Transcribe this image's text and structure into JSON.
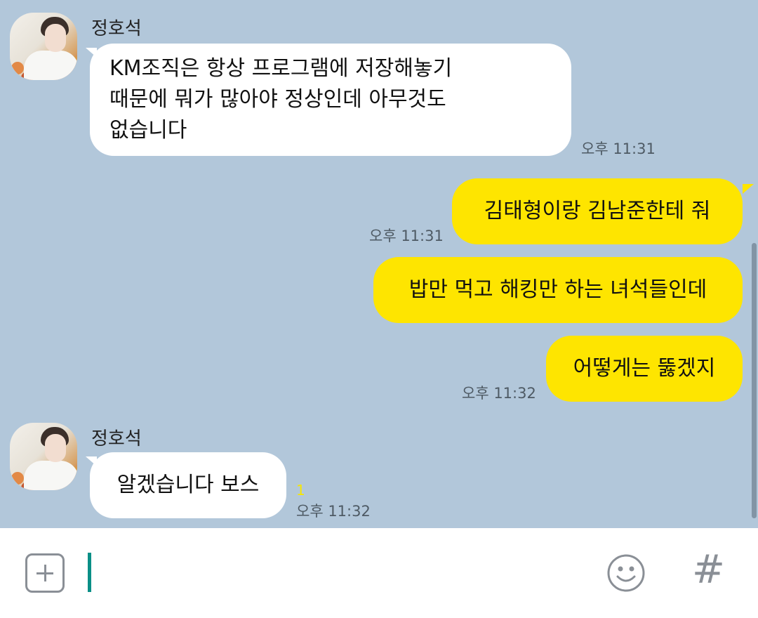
{
  "messages": [
    {
      "sender": "정호석",
      "lines": [
        "KM조직은 항상 프로그램에 저장해놓기",
        "때문에 뭐가 많아야 정상인데 아무것도",
        "없습니다"
      ],
      "time": "오후 11:31",
      "direction": "in"
    },
    {
      "text": "김태형이랑 김남준한테 줘",
      "time": "오후 11:31",
      "direction": "out"
    },
    {
      "text": "밥만 먹고 해킹만 하는 녀석들인데",
      "direction": "out"
    },
    {
      "text": "어떻게는 뚫겠지",
      "time": "오후 11:32",
      "direction": "out"
    },
    {
      "sender": "정호석",
      "text": "알겠습니다 보스",
      "unread": "1",
      "time": "오후 11:32",
      "direction": "in"
    }
  ],
  "input": {
    "value": ""
  },
  "icons": {
    "attach": "plus-square-icon",
    "emoji": "smiley-icon",
    "hashtag": "hashtag-icon"
  },
  "colors": {
    "background": "#b2c7da",
    "outgoing_bubble": "#fee500",
    "incoming_bubble": "#ffffff",
    "cursor": "#0a8f87",
    "unread": "#f7e600"
  }
}
